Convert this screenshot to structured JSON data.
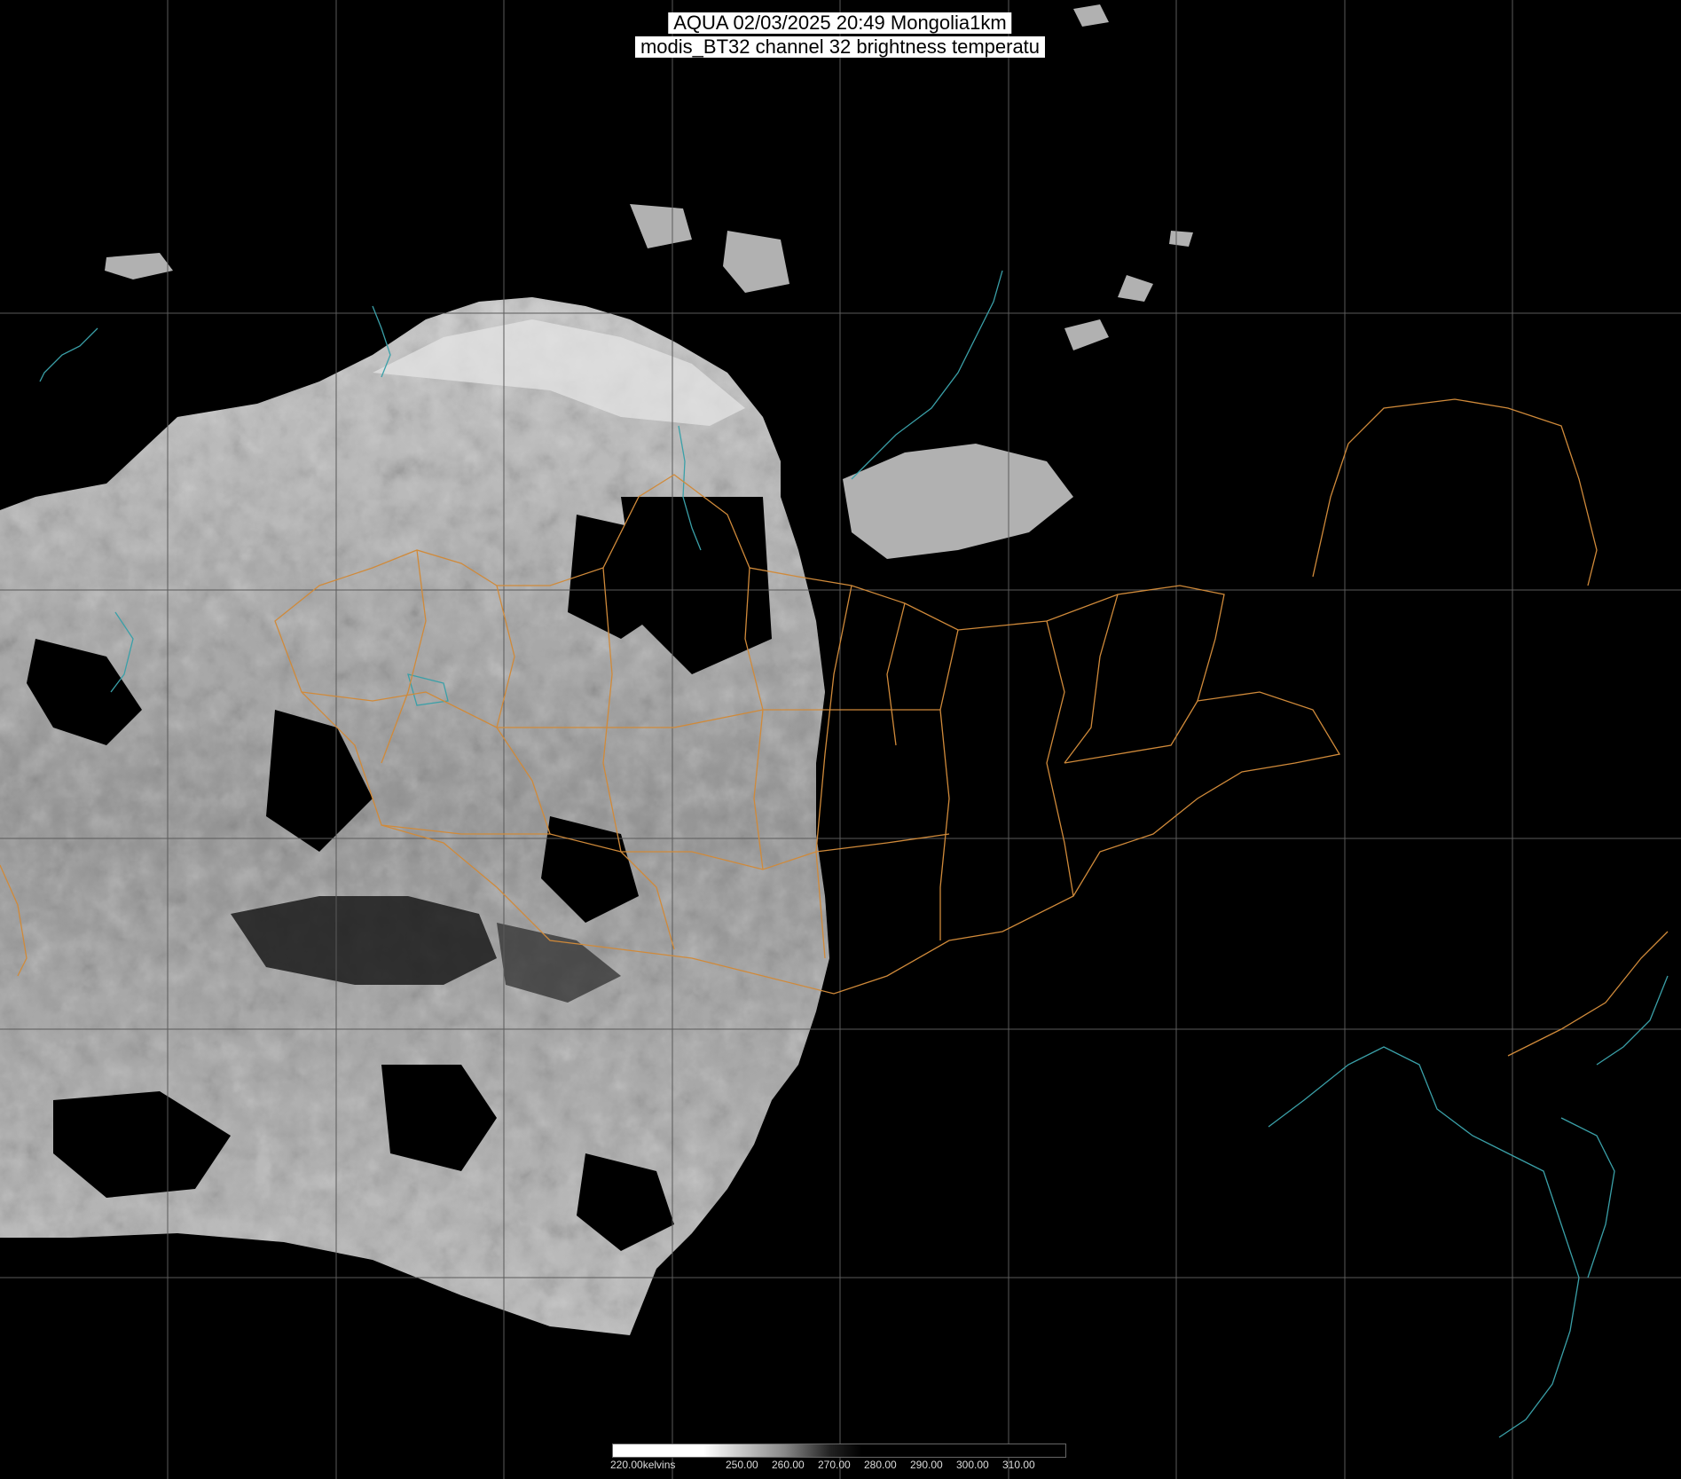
{
  "title": {
    "line1": "AQUA 02/03/2025 20:49 Mongolia1km",
    "line2": "modis_BT32 channel 32 brightness temperatu"
  },
  "legend": {
    "labels": [
      "220.00kelvins",
      "250.00",
      "260.00",
      "270.00",
      "280.00",
      "290.00",
      "300.00",
      "310.00"
    ]
  },
  "colors": {
    "background": "#000000",
    "grid": "#5a5a5a",
    "admin_border": "#d08a3a",
    "coast_water": "#3aa0a8",
    "cloud_bright": "#ffffff",
    "cloud_dark": "#3a3a3a"
  }
}
